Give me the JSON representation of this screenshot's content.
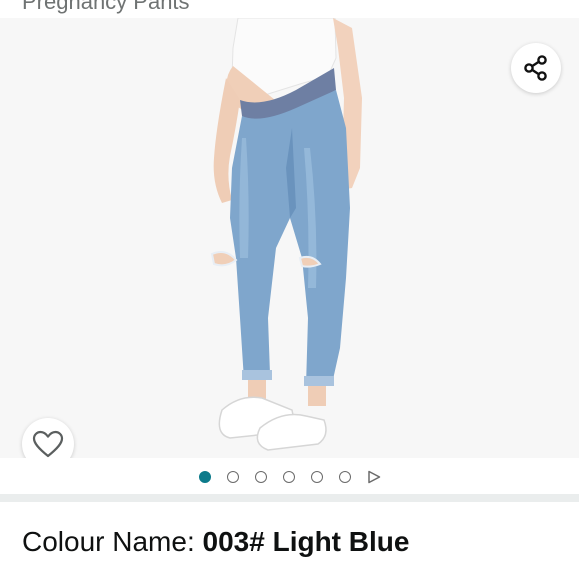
{
  "product": {
    "title_fragment": "Pregnancy Pants"
  },
  "gallery": {
    "image_subject": "maternity skinny jeans light blue with ripped knees",
    "dot_count": 6,
    "active_index": 0,
    "active_color": "#0d7b8b"
  },
  "icons": {
    "share": "share-icon",
    "wishlist": "heart-icon",
    "video": "play-icon"
  },
  "colour": {
    "label": "Colour Name:",
    "value": "003# Light Blue"
  }
}
